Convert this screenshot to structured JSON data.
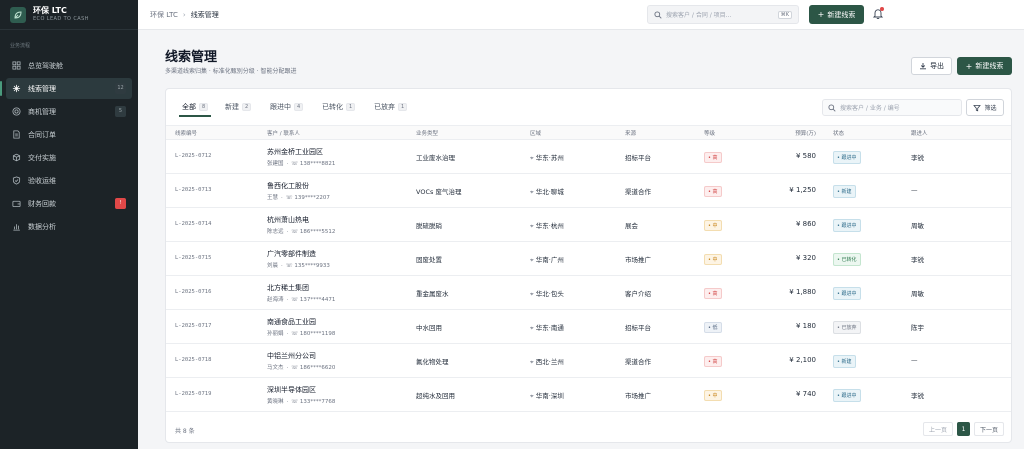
{
  "brand": {
    "title": "环保 LTC",
    "subtitle": "ECO LEAD TO CASH"
  },
  "sidebar": {
    "section_label": "业务流程",
    "items": [
      {
        "label": "总览驾驶舱",
        "icon": "grid-icon",
        "badge": ""
      },
      {
        "label": "线索管理",
        "icon": "sparkle-icon",
        "badge": "12"
      },
      {
        "label": "商机管理",
        "icon": "target-icon",
        "badge": "5"
      },
      {
        "label": "合同订单",
        "icon": "document-icon",
        "badge": ""
      },
      {
        "label": "交付实施",
        "icon": "package-icon",
        "badge": ""
      },
      {
        "label": "验收运维",
        "icon": "shield-check-icon",
        "badge": ""
      },
      {
        "label": "财务回款",
        "icon": "wallet-icon",
        "badge": "!"
      },
      {
        "label": "数据分析",
        "icon": "bar-chart-icon",
        "badge": ""
      }
    ]
  },
  "topbar": {
    "breadcrumb_root": "环保 LTC",
    "breadcrumb_current": "线索管理",
    "search_placeholder": "搜索客户 / 合同 / 项目...",
    "search_shortcut": "⌘K",
    "new_button": "新建线索"
  },
  "page": {
    "title": "线索管理",
    "subtitle": "多渠道线索归集 · 标准化甄别分级 · 智能分配跟进",
    "export_button": "导出",
    "new_button": "新建线索"
  },
  "tabs": [
    {
      "label": "全部",
      "count": "8"
    },
    {
      "label": "新建",
      "count": "2"
    },
    {
      "label": "跟进中",
      "count": "4"
    },
    {
      "label": "已转化",
      "count": "1"
    },
    {
      "label": "已放弃",
      "count": "1"
    }
  ],
  "filter": {
    "search_placeholder": "搜索客户 / 业务 / 编号",
    "filter_button": "筛选"
  },
  "table": {
    "columns": [
      "线索编号",
      "客户 / 联系人",
      "业务类型",
      "区域",
      "来源",
      "等级",
      "预算(万)",
      "状态",
      "跟进人"
    ],
    "rows": [
      {
        "code": "L-2025-0712",
        "customer": "苏州金桥工业园区",
        "contact": "张建国",
        "phone": "138****8821",
        "type": "工业废水治理",
        "region": "华东·苏州",
        "source": "招标平台",
        "priority": "高",
        "priority_level": "high",
        "budget": "¥ 580",
        "status": "跟进中",
        "status_kind": "follow",
        "owner": "李锐"
      },
      {
        "code": "L-2025-0713",
        "customer": "鲁西化工股份",
        "contact": "王慧",
        "phone": "139****2207",
        "type": "VOCs 废气治理",
        "region": "华北·聊城",
        "source": "渠道合作",
        "priority": "高",
        "priority_level": "high",
        "budget": "¥ 1,250",
        "status": "新建",
        "status_kind": "new",
        "owner": "—"
      },
      {
        "code": "L-2025-0714",
        "customer": "杭州萧山热电",
        "contact": "陈志远",
        "phone": "186****5512",
        "type": "脱硫脱硝",
        "region": "华东·杭州",
        "source": "展会",
        "priority": "中",
        "priority_level": "mid",
        "budget": "¥ 860",
        "status": "跟进中",
        "status_kind": "follow",
        "owner": "周敏"
      },
      {
        "code": "L-2025-0715",
        "customer": "广汽零部件制造",
        "contact": "刘晨",
        "phone": "135****9933",
        "type": "固废处置",
        "region": "华南·广州",
        "source": "市场推广",
        "priority": "中",
        "priority_level": "mid",
        "budget": "¥ 320",
        "status": "已转化",
        "status_kind": "conv",
        "owner": "李锐"
      },
      {
        "code": "L-2025-0716",
        "customer": "北方稀土集团",
        "contact": "赵海涛",
        "phone": "137****4471",
        "type": "重金属废水",
        "region": "华北·包头",
        "source": "客户介绍",
        "priority": "高",
        "priority_level": "high",
        "budget": "¥ 1,880",
        "status": "跟进中",
        "status_kind": "follow",
        "owner": "周敏"
      },
      {
        "code": "L-2025-0717",
        "customer": "南通食品工业园",
        "contact": "孙丽娟",
        "phone": "180****1198",
        "type": "中水回用",
        "region": "华东·南通",
        "source": "招标平台",
        "priority": "低",
        "priority_level": "low",
        "budget": "¥ 180",
        "status": "已放弃",
        "status_kind": "drop",
        "owner": "陈宇"
      },
      {
        "code": "L-2025-0718",
        "customer": "中铝兰州分公司",
        "contact": "马文杰",
        "phone": "186****6620",
        "type": "氟化物处理",
        "region": "西北·兰州",
        "source": "渠道合作",
        "priority": "高",
        "priority_level": "high",
        "budget": "¥ 2,100",
        "status": "新建",
        "status_kind": "new",
        "owner": "—"
      },
      {
        "code": "L-2025-0719",
        "customer": "深圳半导体园区",
        "contact": "黄晓琳",
        "phone": "133****7768",
        "type": "超纯水及回用",
        "region": "华南·深圳",
        "source": "市场推广",
        "priority": "中",
        "priority_level": "mid",
        "budget": "¥ 740",
        "status": "跟进中",
        "status_kind": "follow",
        "owner": "李锐"
      }
    ]
  },
  "pagination": {
    "total": "共 8 条",
    "prev": "上一页",
    "current": "1",
    "next": "下一页"
  },
  "colors": {
    "accent": "#2c5646",
    "sidebar_bg": "#1c2327",
    "danger": "#e04848"
  }
}
